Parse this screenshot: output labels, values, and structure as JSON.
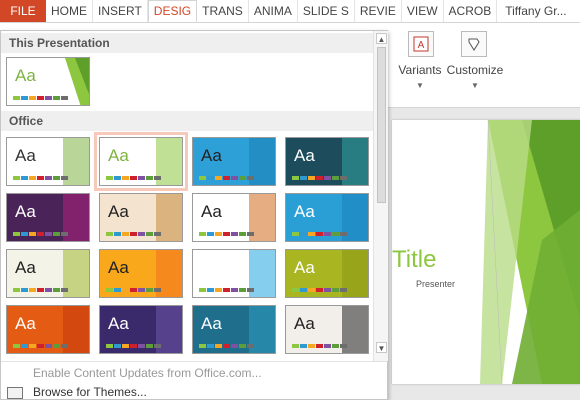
{
  "ribbon": {
    "tabs": [
      {
        "label": "FILE",
        "kind": "file"
      },
      {
        "label": "HOME"
      },
      {
        "label": "INSERT"
      },
      {
        "label": "DESIG",
        "kind": "active"
      },
      {
        "label": "TRANS"
      },
      {
        "label": "ANIMA"
      },
      {
        "label": "SLIDE S"
      },
      {
        "label": "REVIE"
      },
      {
        "label": "VIEW"
      },
      {
        "label": "ACROB"
      },
      {
        "label": "Tiffany Gr...",
        "kind": "user"
      }
    ],
    "variants_label": "Variants",
    "customize_label": "Customize"
  },
  "gallery": {
    "section_this": "This Presentation",
    "section_office": "Office",
    "themes": [
      {
        "aa": "Aa",
        "bg": "#ffffff",
        "fg": "#333333",
        "accent": "#7fb341"
      },
      {
        "aa": "Aa",
        "bg": "#ffffff",
        "fg": "#7fb341",
        "accent": "#8dc63f",
        "selected": true
      },
      {
        "aa": "Aa",
        "bg": "#2ea0d8",
        "fg": "#222222",
        "accent": "#1a7fb5"
      },
      {
        "aa": "Aa",
        "bg": "#1d4d5c",
        "fg": "#ffffff",
        "accent": "#2fa6a0"
      },
      {
        "aa": "Aa",
        "bg": "#4a2458",
        "fg": "#ffffff",
        "accent": "#b0217d"
      },
      {
        "aa": "Aa",
        "bg": "#f4e4cf",
        "fg": "#222222",
        "accent": "#c58b3e"
      },
      {
        "aa": "Aa",
        "bg": "#ffffff",
        "fg": "#222222",
        "accent": "#d2691e"
      },
      {
        "aa": "Aa",
        "bg": "#2a9fd6",
        "fg": "#ffffff",
        "accent": "#1c7fbd"
      },
      {
        "aa": "Aa",
        "bg": "#f3f3e8",
        "fg": "#222222",
        "accent": "#a0b830"
      },
      {
        "aa": "Aa",
        "bg": "#f9a81c",
        "fg": "#222222",
        "accent": "#f37021"
      },
      {
        "aa": "Aa",
        "bg": "#ffffff",
        "fg": "#ffffff",
        "accent": "#22a5e0"
      },
      {
        "aa": "Aa",
        "bg": "#a9b521",
        "fg": "#ffffff",
        "accent": "#8a9717"
      },
      {
        "aa": "Aa",
        "bg": "#e45c13",
        "fg": "#ffffff",
        "accent": "#c3390b"
      },
      {
        "aa": "Aa",
        "bg": "#3b2a6b",
        "fg": "#ffffff",
        "accent": "#6b53a8"
      },
      {
        "aa": "Aa",
        "bg": "#1f6e8c",
        "fg": "#ffffff",
        "accent": "#2c9cc0"
      },
      {
        "aa": "Aa",
        "bg": "#f2efea",
        "fg": "#222222",
        "accent": "#222222"
      }
    ],
    "this_theme": {
      "aa": "Aa",
      "fg": "#7fb341"
    },
    "bar_colors": [
      "#8dc63f",
      "#2f9ad1",
      "#f5a623",
      "#d0202e",
      "#7f51a0",
      "#5b9e3a",
      "#6d6d6d"
    ],
    "footer": {
      "updates": "Enable Content Updates from Office.com...",
      "browse": "Browse for Themes..."
    }
  },
  "slide": {
    "title": "Title",
    "subtitle": "Presenter"
  }
}
